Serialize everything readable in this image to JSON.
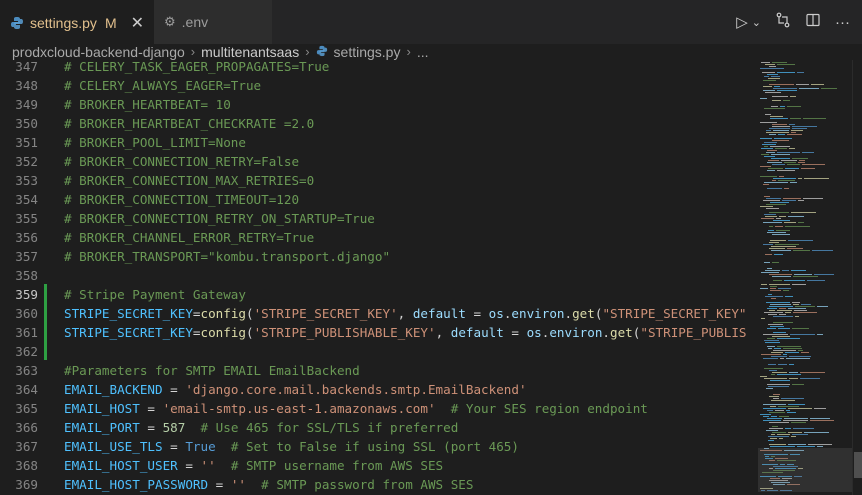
{
  "tabs": [
    {
      "label": "settings.py",
      "modified": "M",
      "active": true,
      "icon": "python-icon"
    },
    {
      "label": ".env",
      "active": false,
      "icon": "gear-icon"
    }
  ],
  "toolbar_icons": [
    "run-icon",
    "chevron-down-icon",
    "source-control-compare-icon",
    "split-editor-icon",
    "more-actions-icon"
  ],
  "breadcrumb": {
    "items": [
      "prodxcloud-backend-django",
      "multitenantsaas",
      "settings.py",
      "..."
    ]
  },
  "colors": {
    "comment": "#6a9955",
    "variable": "#4fc1ff",
    "function": "#dcdcaa",
    "string": "#ce9178",
    "keyword": "#569cd6",
    "number": "#b5cea8",
    "modified_gutter": "#2ea043",
    "tab_modified": "#e2c08d"
  },
  "editor": {
    "lines": [
      {
        "n": "347",
        "tokens": [
          {
            "t": "# CELERY_TASK_EAGER_PROPAGATES=True",
            "c": "comment"
          }
        ]
      },
      {
        "n": "348",
        "tokens": [
          {
            "t": "# CELERY_ALWAYS_EAGER=True",
            "c": "comment"
          }
        ]
      },
      {
        "n": "349",
        "tokens": [
          {
            "t": "# BROKER_HEARTBEAT= 10",
            "c": "comment"
          }
        ]
      },
      {
        "n": "350",
        "tokens": [
          {
            "t": "# BROKER_HEARTBEAT_CHECKRATE =2.0",
            "c": "comment"
          }
        ]
      },
      {
        "n": "351",
        "tokens": [
          {
            "t": "# BROKER_POOL_LIMIT=None",
            "c": "comment"
          }
        ]
      },
      {
        "n": "352",
        "tokens": [
          {
            "t": "# BROKER_CONNECTION_RETRY=False",
            "c": "comment"
          }
        ]
      },
      {
        "n": "353",
        "tokens": [
          {
            "t": "# BROKER_CONNECTION_MAX_RETRIES=0",
            "c": "comment"
          }
        ]
      },
      {
        "n": "354",
        "tokens": [
          {
            "t": "# BROKER_CONNECTION_TIMEOUT=120",
            "c": "comment"
          }
        ]
      },
      {
        "n": "355",
        "tokens": [
          {
            "t": "# BROKER_CONNECTION_RETRY_ON_STARTUP=True",
            "c": "comment"
          }
        ]
      },
      {
        "n": "356",
        "tokens": [
          {
            "t": "# BROKER_CHANNEL_ERROR_RETRY=True",
            "c": "comment"
          }
        ]
      },
      {
        "n": "357",
        "tokens": [
          {
            "t": "# BROKER_TRANSPORT=\"kombu.transport.django\"",
            "c": "comment"
          }
        ]
      },
      {
        "n": "358",
        "tokens": []
      },
      {
        "n": "359",
        "current": true,
        "tokens": [
          {
            "t": "# Stripe Payment Gateway",
            "c": "comment"
          }
        ]
      },
      {
        "n": "360",
        "tokens": [
          {
            "t": "STRIPE_SECRET_KEY",
            "c": "variable"
          },
          {
            "t": "=",
            "c": "plain"
          },
          {
            "t": "config",
            "c": "function"
          },
          {
            "t": "(",
            "c": "plain"
          },
          {
            "t": "'STRIPE_SECRET_KEY'",
            "c": "string"
          },
          {
            "t": ", ",
            "c": "plain"
          },
          {
            "t": "default",
            "c": "param"
          },
          {
            "t": " = ",
            "c": "plain"
          },
          {
            "t": "os",
            "c": "param"
          },
          {
            "t": ".",
            "c": "plain"
          },
          {
            "t": "environ",
            "c": "param"
          },
          {
            "t": ".",
            "c": "plain"
          },
          {
            "t": "get",
            "c": "function"
          },
          {
            "t": "(",
            "c": "plain"
          },
          {
            "t": "\"STRIPE_SECRET_KEY\"",
            "c": "string"
          }
        ]
      },
      {
        "n": "361",
        "tokens": [
          {
            "t": "STRIPE_SECRET_KEY",
            "c": "variable"
          },
          {
            "t": "=",
            "c": "plain"
          },
          {
            "t": "config",
            "c": "function"
          },
          {
            "t": "(",
            "c": "plain"
          },
          {
            "t": "'STRIPE_PUBLISHABLE_KEY'",
            "c": "string"
          },
          {
            "t": ", ",
            "c": "plain"
          },
          {
            "t": "default",
            "c": "param"
          },
          {
            "t": " = ",
            "c": "plain"
          },
          {
            "t": "os",
            "c": "param"
          },
          {
            "t": ".",
            "c": "plain"
          },
          {
            "t": "environ",
            "c": "param"
          },
          {
            "t": ".",
            "c": "plain"
          },
          {
            "t": "get",
            "c": "function"
          },
          {
            "t": "(",
            "c": "plain"
          },
          {
            "t": "\"STRIPE_PUBLIS",
            "c": "string"
          }
        ]
      },
      {
        "n": "362",
        "tokens": []
      },
      {
        "n": "363",
        "tokens": [
          {
            "t": "#Parameters for SMTP EMAIL EmailBackend",
            "c": "comment"
          }
        ]
      },
      {
        "n": "364",
        "tokens": [
          {
            "t": "EMAIL_BACKEND",
            "c": "variable"
          },
          {
            "t": " = ",
            "c": "plain"
          },
          {
            "t": "'django.core.mail.backends.smtp.EmailBackend'",
            "c": "string"
          }
        ]
      },
      {
        "n": "365",
        "tokens": [
          {
            "t": "EMAIL_HOST",
            "c": "variable"
          },
          {
            "t": " = ",
            "c": "plain"
          },
          {
            "t": "'email-smtp.us-east-1.amazonaws.com'",
            "c": "string"
          },
          {
            "t": "  ",
            "c": "plain"
          },
          {
            "t": "# Your SES region endpoint",
            "c": "comment"
          }
        ]
      },
      {
        "n": "366",
        "tokens": [
          {
            "t": "EMAIL_PORT",
            "c": "variable"
          },
          {
            "t": " = ",
            "c": "plain"
          },
          {
            "t": "587",
            "c": "number"
          },
          {
            "t": "  ",
            "c": "plain"
          },
          {
            "t": "# Use 465 for SSL/TLS if preferred",
            "c": "comment"
          }
        ]
      },
      {
        "n": "367",
        "tokens": [
          {
            "t": "EMAIL_USE_TLS",
            "c": "variable"
          },
          {
            "t": " = ",
            "c": "plain"
          },
          {
            "t": "True",
            "c": "keyword"
          },
          {
            "t": "  ",
            "c": "plain"
          },
          {
            "t": "# Set to False if using SSL (port 465)",
            "c": "comment"
          }
        ]
      },
      {
        "n": "368",
        "tokens": [
          {
            "t": "EMAIL_HOST_USER",
            "c": "variable"
          },
          {
            "t": " = ",
            "c": "plain"
          },
          {
            "t": "''",
            "c": "string"
          },
          {
            "t": "  ",
            "c": "plain"
          },
          {
            "t": "# SMTP username from AWS SES",
            "c": "comment"
          }
        ]
      },
      {
        "n": "369",
        "tokens": [
          {
            "t": "EMAIL_HOST_PASSWORD",
            "c": "variable"
          },
          {
            "t": " = ",
            "c": "plain"
          },
          {
            "t": "''",
            "c": "string"
          },
          {
            "t": "  ",
            "c": "plain"
          },
          {
            "t": "# SMTP password from AWS SES",
            "c": "comment"
          }
        ]
      }
    ]
  }
}
